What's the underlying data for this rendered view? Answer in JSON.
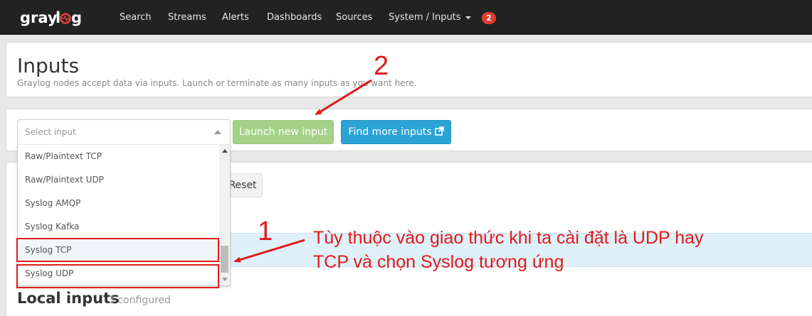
{
  "navbar": {
    "brand": "graylog",
    "items": [
      {
        "label": "Search"
      },
      {
        "label": "Streams"
      },
      {
        "label": "Alerts"
      },
      {
        "label": "Dashboards"
      },
      {
        "label": "Sources"
      },
      {
        "label": "System / Inputs"
      }
    ],
    "notification_count": "2"
  },
  "header": {
    "title": "Inputs",
    "description": "Graylog nodes accept data via inputs. Launch or terminate as many inputs as you want here."
  },
  "input_form": {
    "select_placeholder": "Select input",
    "options": [
      "Raw/Plaintext TCP",
      "Raw/Plaintext UDP",
      "Syslog AMQP",
      "Syslog Kafka",
      "Syslog TCP",
      "Syslog UDP"
    ],
    "launch_label": "Launch new input",
    "find_more_label": "Find more inputs"
  },
  "filter": {
    "reset_label": "Reset"
  },
  "local_inputs": {
    "title": "Local inputs",
    "count_label": "3 configured"
  },
  "annotations": {
    "marker_1": "1",
    "marker_2": "2",
    "note_line_1": "Tùy thuộc vào giao thức khi ta cài đặt là UDP hay",
    "note_line_2": "TCP và chọn Syslog tương ứng"
  },
  "colors": {
    "annotation_red": "#e21a1a",
    "launch_button": "#a6d189",
    "find_button": "#2ba3d6",
    "navbar_bg": "#222222",
    "badge": "#e23b2e"
  }
}
